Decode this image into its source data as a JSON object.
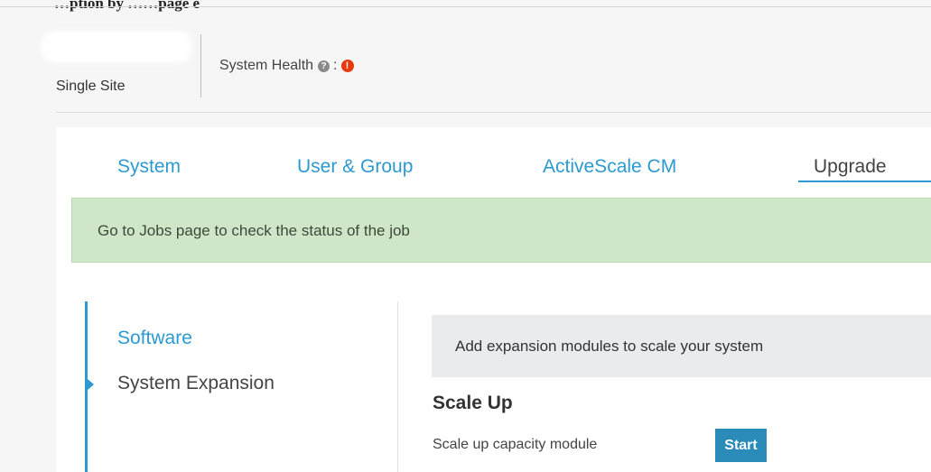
{
  "document": {
    "caption": "…ption    by                    ……page    e"
  },
  "header": {
    "site_label": "Single Site",
    "system_health_label": "System Health",
    "help_icon": "question-circle-icon",
    "separator": ":",
    "health_status_icon": "exclamation-circle-icon",
    "health_status_color": "#e8390e"
  },
  "tabs": [
    {
      "label": "System",
      "active": false
    },
    {
      "label": "User & Group",
      "active": false
    },
    {
      "label": "ActiveScale CM",
      "active": false
    },
    {
      "label": "Upgrade",
      "active": true
    }
  ],
  "banner": {
    "message": "Go to Jobs page to check the status of the job",
    "color": "#cfe6c8"
  },
  "subnav": {
    "items": [
      {
        "label": "Software",
        "active": false
      },
      {
        "label": "System Expansion",
        "active": true
      }
    ]
  },
  "content": {
    "info_text": "Add expansion modules to scale your system",
    "section_title": "Scale Up",
    "row_label": "Scale up capacity module",
    "start_button": "Start"
  },
  "colors": {
    "accent": "#2c9ad1",
    "button": "#2a8ab8"
  }
}
